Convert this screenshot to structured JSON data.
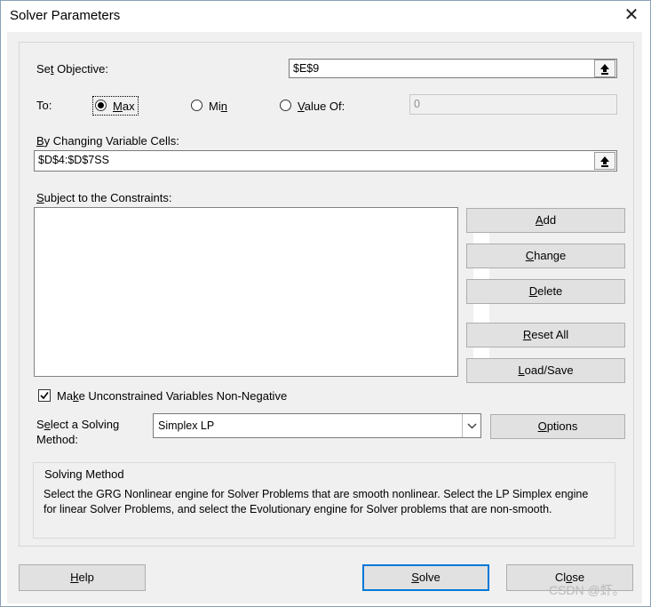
{
  "window": {
    "title": "Solver Parameters",
    "close_glyph": "✕"
  },
  "objective": {
    "label_pre": "Se",
    "label_key": "t",
    "label_post": " Objective:",
    "value": "$E$9"
  },
  "to": {
    "label": "To:",
    "options": [
      {
        "pre": "",
        "key": "M",
        "post": "ax",
        "selected": true
      },
      {
        "pre": "Mi",
        "key": "n",
        "post": "",
        "selected": false
      },
      {
        "pre": "",
        "key": "V",
        "post": "alue Of:",
        "selected": false
      }
    ],
    "value_of": "0"
  },
  "changing": {
    "label_pre": "",
    "label_key": "B",
    "label_post": "y Changing Variable Cells:",
    "value": "$D$4:$D$7SS"
  },
  "constraints": {
    "label_pre": "",
    "label_key": "S",
    "label_post": "ubject to the Constraints:",
    "items": []
  },
  "side_buttons": {
    "add": {
      "pre": "",
      "key": "A",
      "post": "dd"
    },
    "change": {
      "pre": "",
      "key": "C",
      "post": "hange"
    },
    "delete": {
      "pre": "",
      "key": "D",
      "post": "elete"
    },
    "reset_all": {
      "pre": "",
      "key": "R",
      "post": "eset All"
    },
    "load_save": {
      "pre": "",
      "key": "L",
      "post": "oad/Save"
    }
  },
  "nonneg": {
    "pre": "Ma",
    "key": "k",
    "post": "e Unconstrained Variables Non-Negative",
    "checked": true
  },
  "method": {
    "label_line1_pre": "S",
    "label_line1_key": "e",
    "label_line1_post": "lect a Solving",
    "label_line2": "Method:",
    "selected": "Simplex LP",
    "options_button": {
      "pre": "",
      "key": "O",
      "post": "ptions"
    }
  },
  "solving_method_group": {
    "title": "Solving Method",
    "description": "Select the GRG Nonlinear engine for Solver Problems that are smooth nonlinear. Select the LP Simplex engine for linear Solver Problems, and select the Evolutionary engine for Solver problems that are non-smooth."
  },
  "footer": {
    "help": {
      "pre": "",
      "key": "H",
      "post": "elp"
    },
    "solve": {
      "pre": "",
      "key": "S",
      "post": "olve"
    },
    "close": {
      "pre": "Cl",
      "key": "o",
      "post": "se"
    }
  },
  "watermark": "CSDN @虾。"
}
